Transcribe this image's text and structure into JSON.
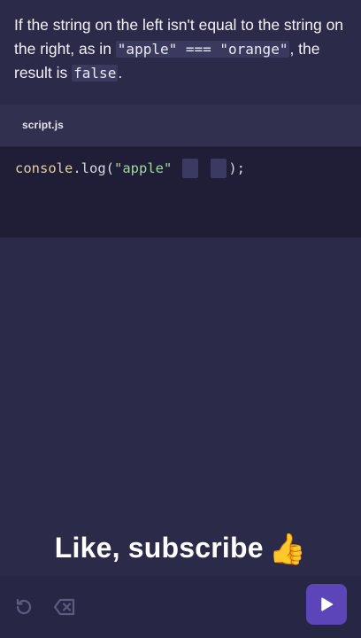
{
  "lesson": {
    "part1": "If the string on the left isn't equal to the string on the right, as in ",
    "code1": "\"apple\" === \"orange\"",
    "part2": ", the result is ",
    "code2": "false",
    "part3": "."
  },
  "tab": {
    "label": "script.js"
  },
  "code": {
    "object": "console",
    "dot": ".",
    "method": "log",
    "open_paren": "(",
    "string": "\"apple\"",
    "close": ");"
  },
  "overlay": {
    "text": "Like, subscribe",
    "emoji": "👍"
  },
  "controls": {
    "undo_icon": "undo-icon",
    "delete_icon": "backspace-icon",
    "run_icon": "play-icon"
  }
}
